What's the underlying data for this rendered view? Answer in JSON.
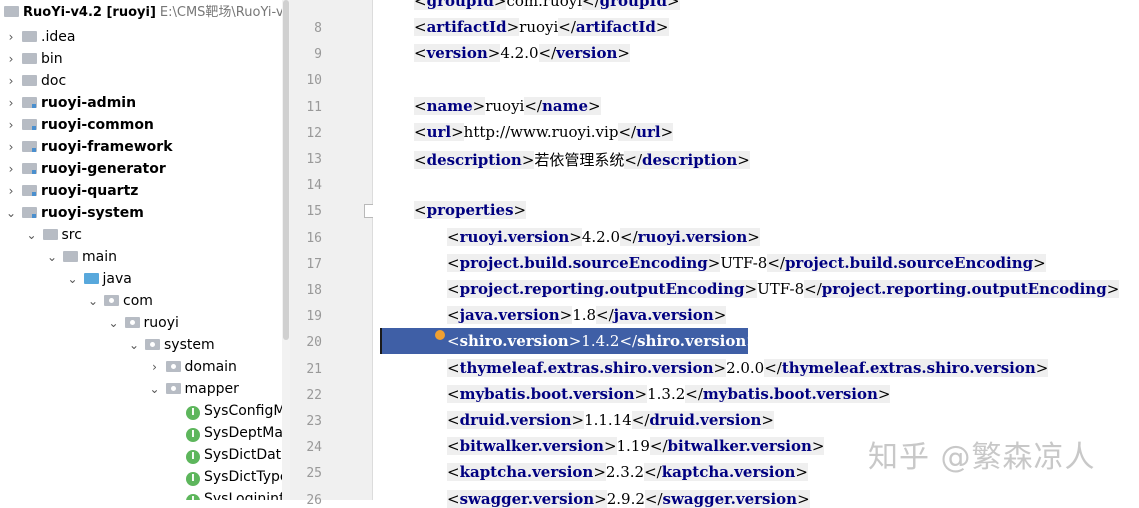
{
  "project": {
    "name": "RuoYi-v4.2 [ruoyi]",
    "path": "E:\\CMS靶场\\RuoYi-v4.2"
  },
  "tree": [
    {
      "label": ".idea",
      "arrow": "›",
      "icon": "folder-gray",
      "bold": false
    },
    {
      "label": "bin",
      "arrow": "›",
      "icon": "folder-gray",
      "bold": false
    },
    {
      "label": "doc",
      "arrow": "›",
      "icon": "folder-gray",
      "bold": false
    },
    {
      "label": "ruoyi-admin",
      "arrow": "›",
      "icon": "module-folder",
      "bold": true
    },
    {
      "label": "ruoyi-common",
      "arrow": "›",
      "icon": "module-folder",
      "bold": true
    },
    {
      "label": "ruoyi-framework",
      "arrow": "›",
      "icon": "module-folder",
      "bold": true
    },
    {
      "label": "ruoyi-generator",
      "arrow": "›",
      "icon": "module-folder",
      "bold": true
    },
    {
      "label": "ruoyi-quartz",
      "arrow": "›",
      "icon": "module-folder",
      "bold": true
    },
    {
      "label": "ruoyi-system",
      "arrow": "⌄",
      "icon": "module-folder",
      "bold": true
    },
    {
      "label": "src",
      "arrow": "⌄",
      "icon": "folder-gray",
      "bold": false
    },
    {
      "label": "main",
      "arrow": "⌄",
      "icon": "folder-gray",
      "bold": false
    },
    {
      "label": "java",
      "arrow": "⌄",
      "icon": "folder-blue",
      "bold": false
    },
    {
      "label": "com",
      "arrow": "⌄",
      "icon": "package-folder",
      "bold": false
    },
    {
      "label": "ruoyi",
      "arrow": "⌄",
      "icon": "package-folder",
      "bold": false
    },
    {
      "label": "system",
      "arrow": "⌄",
      "icon": "package-folder",
      "bold": false
    },
    {
      "label": "domain",
      "arrow": "›",
      "icon": "package-folder",
      "bold": false
    },
    {
      "label": "mapper",
      "arrow": "⌄",
      "icon": "package-folder",
      "bold": false
    },
    {
      "label": "SysConfigMa",
      "arrow": "",
      "icon": "interface-icon",
      "bold": false
    },
    {
      "label": "SysDeptMap",
      "arrow": "",
      "icon": "interface-icon",
      "bold": false
    },
    {
      "label": "SysDictDataM",
      "arrow": "",
      "icon": "interface-icon",
      "bold": false
    },
    {
      "label": "SysDictTypeM",
      "arrow": "",
      "icon": "interface-icon",
      "bold": false
    },
    {
      "label": "SysLogininfo",
      "arrow": "",
      "icon": "interface-icon",
      "bold": false
    }
  ],
  "interface_glyph": "I",
  "line_numbers": [
    "8",
    "9",
    "10",
    "11",
    "12",
    "13",
    "14",
    "15",
    "16",
    "17",
    "18",
    "19",
    "20",
    "21",
    "22",
    "23",
    "24",
    "25",
    "26"
  ],
  "code_lines": [
    {
      "line": "7",
      "tag": "groupId",
      "value": "com.ruoyi",
      "indent": 0
    },
    {
      "line": "8",
      "tag": "artifactId",
      "value": "ruoyi",
      "indent": 0
    },
    {
      "line": "9",
      "tag": "version",
      "value": "4.2.0",
      "indent": 0
    },
    {
      "line": "11",
      "tag": "name",
      "value": "ruoyi",
      "indent": 0
    },
    {
      "line": "12",
      "tag": "url",
      "value": "http://www.ruoyi.vip",
      "indent": 0
    },
    {
      "line": "13",
      "tag": "description",
      "value": "若依管理系统",
      "indent": 0
    },
    {
      "line": "15",
      "tag": "properties",
      "value": "",
      "indent": 0,
      "open_only": true
    },
    {
      "line": "16",
      "tag": "ruoyi.version",
      "value": "4.2.0",
      "indent": 1
    },
    {
      "line": "17",
      "tag": "project.build.sourceEncoding",
      "value": "UTF-8",
      "indent": 1
    },
    {
      "line": "18",
      "tag": "project.reporting.outputEncoding",
      "value": "UTF-8",
      "indent": 1
    },
    {
      "line": "19",
      "tag": "java.version",
      "value": "1.8",
      "indent": 1
    },
    {
      "line": "20",
      "tag": "shiro.version",
      "value": "1.4.2",
      "indent": 1,
      "selected": true
    },
    {
      "line": "21",
      "tag": "thymeleaf.extras.shiro.version",
      "value": "2.0.0",
      "indent": 1
    },
    {
      "line": "22",
      "tag": "mybatis.boot.version",
      "value": "1.3.2",
      "indent": 1
    },
    {
      "line": "23",
      "tag": "druid.version",
      "value": "1.1.14",
      "indent": 1
    },
    {
      "line": "24",
      "tag": "bitwalker.version",
      "value": "1.19",
      "indent": 1
    },
    {
      "line": "25",
      "tag": "kaptcha.version",
      "value": "2.3.2",
      "indent": 1
    },
    {
      "line": "26",
      "tag": "swagger.version",
      "value": "2.9.2",
      "indent": 1
    }
  ],
  "watermark": "知乎 @繁森凉人",
  "colors": {
    "tag_name": "#000080",
    "selection": "#3f5fa6",
    "bulb": "#f0a030"
  }
}
